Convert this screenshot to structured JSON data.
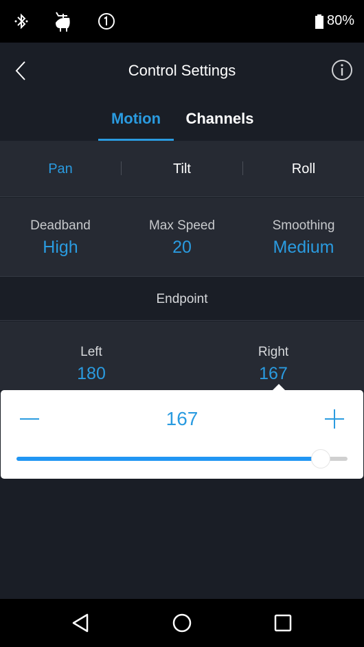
{
  "status_bar": {
    "icons": [
      "bluetooth-icon",
      "pet-notification-icon",
      "sim-1-icon"
    ],
    "battery_icon": "battery-icon",
    "battery_percent": "80%"
  },
  "app_bar": {
    "back_icon": "chevron-left-icon",
    "title": "Control Settings",
    "info_icon": "info-icon"
  },
  "tabs": [
    {
      "label": "Motion",
      "active": true
    },
    {
      "label": "Channels",
      "active": false
    }
  ],
  "axes": [
    {
      "label": "Pan",
      "active": true
    },
    {
      "label": "Tilt",
      "active": false
    },
    {
      "label": "Roll",
      "active": false
    }
  ],
  "params": [
    {
      "label": "Deadband",
      "value": "High"
    },
    {
      "label": "Max Speed",
      "value": "20"
    },
    {
      "label": "Smoothing",
      "value": "Medium"
    }
  ],
  "endpoint": {
    "header": "Endpoint",
    "left": {
      "label": "Left",
      "value": "180"
    },
    "right": {
      "label": "Right",
      "value": "167"
    }
  },
  "popup": {
    "value": "167",
    "minus_icon": "minus-icon",
    "plus_icon": "plus-icon",
    "slider_fraction": 0.92
  },
  "nav_bar": {
    "buttons": [
      "back-triangle-icon",
      "home-circle-icon",
      "recents-square-icon"
    ]
  },
  "colors": {
    "accent": "#2a9be0",
    "background": "#1a1e26",
    "panel": "#262a33"
  }
}
